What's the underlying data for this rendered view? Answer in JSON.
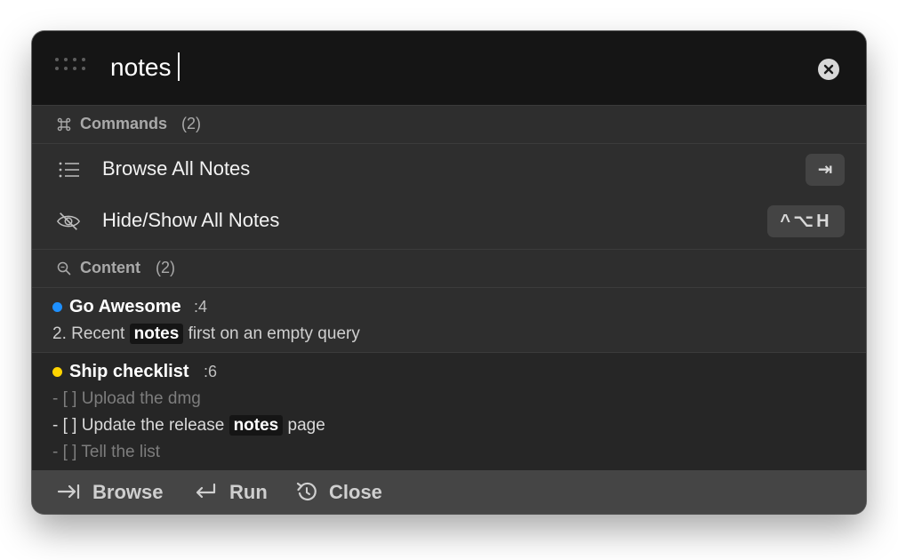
{
  "search": {
    "value": "notes",
    "clear_icon": "close-circle-icon",
    "grip_icon": "drag-handle-icon"
  },
  "commands_section": {
    "icon": "command-key-icon",
    "label": "Commands",
    "count": "(2)"
  },
  "commands": [
    {
      "icon": "list-icon",
      "label": "Browse All Notes",
      "shortcut": "⇥"
    },
    {
      "icon": "eye-slash-icon",
      "label": "Hide/Show All Notes",
      "shortcut": "^⌥H"
    }
  ],
  "content_section": {
    "icon": "magnifier-icon",
    "label": "Content",
    "count": "(2)"
  },
  "results": [
    {
      "dot_color": "#1e90ff",
      "title": "Go Awesome",
      "line": ":4",
      "snippet_pre": "2. Recent ",
      "snippet_highlight": "notes",
      "snippet_post": " first on an empty query"
    },
    {
      "dot_color": "#ffd400",
      "title": "Ship checklist",
      "line": ":6",
      "line_before": "- [ ] Upload the dmg",
      "match_pre": "- [ ] Update the release ",
      "match_highlight": "notes",
      "match_post": " page",
      "line_after": "- [ ] Tell the list"
    }
  ],
  "footer": {
    "browse_icon": "tab-arrow-icon",
    "browse_label": "Browse",
    "run_icon": "return-icon",
    "run_label": "Run",
    "close_icon": "undo-circle-icon",
    "close_label": "Close"
  },
  "colors": {
    "window_bg": "#2e2e2e",
    "search_bg": "#151515",
    "footer_bg": "#454545",
    "selected_bg": "#262626"
  }
}
